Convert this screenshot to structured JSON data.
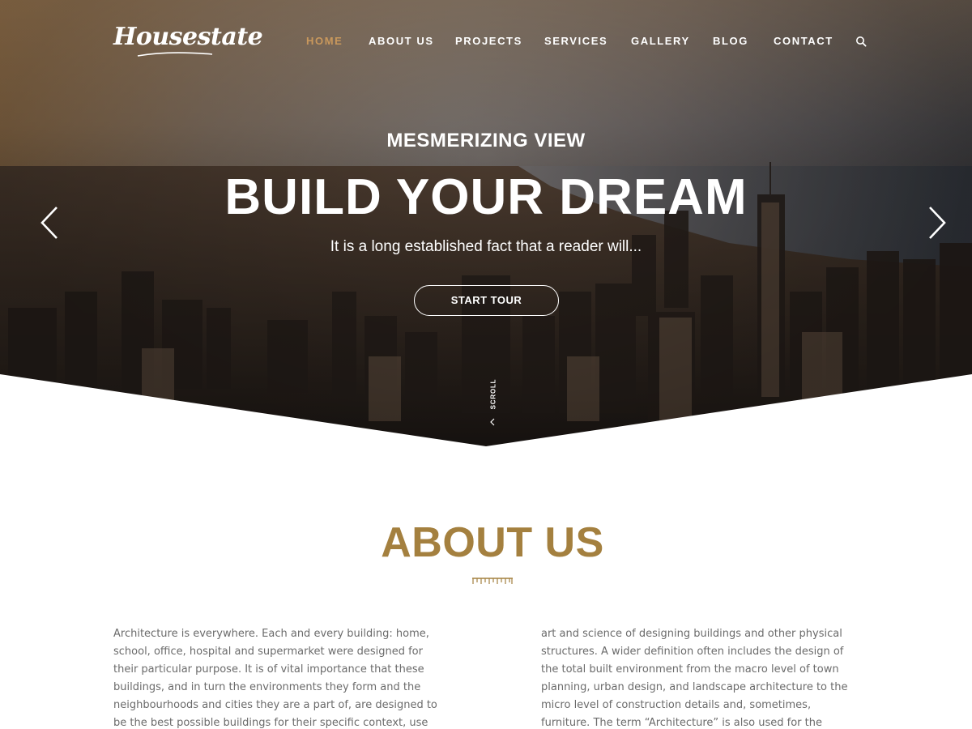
{
  "brand": {
    "logo_text": "Housestate"
  },
  "nav": {
    "items": [
      {
        "label": "HOME",
        "active": true
      },
      {
        "label": "ABOUT US",
        "active": false
      },
      {
        "label": "PROJECTS",
        "active": false
      },
      {
        "label": "SERVICES",
        "active": false
      },
      {
        "label": "GALLERY",
        "active": false
      },
      {
        "label": "BLOG",
        "active": false
      },
      {
        "label": "CONTACT",
        "active": false
      }
    ],
    "search_icon": "search-icon"
  },
  "hero": {
    "kicker": "MESMERIZING VIEW",
    "headline": "BUILD YOUR DREAM",
    "subline": "It is a long established fact that a reader will...",
    "cta_label": "START TOUR",
    "prev_icon": "chevron-left-icon",
    "next_icon": "chevron-right-icon",
    "scroll_label": "SCROLL"
  },
  "about": {
    "title": "ABOUT US",
    "divider_icon": "ruler-icon",
    "col_left": "Architecture is everywhere. Each and every building: home, school, office, hospital and supermarket were designed for their particular purpose. It is of vital importance that these buildings, and in turn the environments they form and the neighbourhoods and cities they are a part of, are designed to be the best possible buildings for their specific context, use and the people who use",
    "col_right": "art and science of designing buildings and other physical structures. A wider definition often includes the design of the total built environment from the macro level of town planning, urban design, and landscape architecture to the micro level of construction details and, sometimes, furniture. The term “Architecture” is also used for the profession of providing"
  },
  "colors": {
    "accent": "#a4803f",
    "nav_active": "#c9985c",
    "body_text": "#6b6b6b",
    "white": "#ffffff"
  }
}
